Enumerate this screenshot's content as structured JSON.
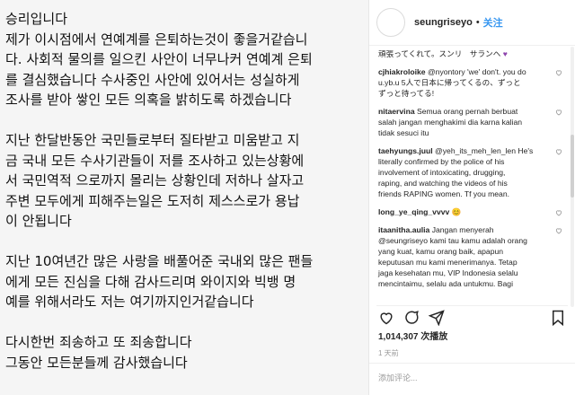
{
  "post": {
    "lines": [
      "승리입니다",
      "제가 이시점에서 연예계를 은퇴하는것이 좋을거같습니",
      "다. 사회적 물의를 일으킨 사안이 너무나커 연예계 은퇴",
      "를 결심했습니다 수사중인 사안에 있어서는 성실하게",
      "조사를 받아 쌓인 모든 의혹을 밝히도록 하겠습니다",
      "",
      "지난 한달반동안 국민들로부터 질타받고 미움받고 지",
      "금 국내 모든 수사기관들이 저를 조사하고 있는상황에",
      "서 국민역적 으로까지 몰리는 상황인데 저하나 살자고",
      "주변 모두에게 피해주는일은 도저히 제스스로가 용납",
      "이 안됩니다",
      "",
      "지난 10여년간 많은 사랑을 배풀어준 국내외 많은 팬들",
      "에게 모든 진심을 다해 감사드리며   와이지와 빅뱅 명",
      "예를 위해서라도 저는 여기까지인거같습니다",
      "",
      "다시한번 죄송하고 또 죄송합니다",
      "그동안 모든분들께 감사했습니다"
    ]
  },
  "header": {
    "username": "seungriseyo",
    "dot": "•",
    "follow_label": "关注"
  },
  "comments": {
    "partial_top": "頑張ってくれて。スンリ　サランヘ",
    "items": [
      {
        "user": "cjhiakroloike",
        "lines": [
          "@nyontory 'we' don't. you do",
          "u.yb.u 5人で日本に帰ってくるの、ずっと",
          "ずっと待ってる!"
        ]
      },
      {
        "user": "nitaervina",
        "lines": [
          "Semua orang pernah berbuat",
          "salah jangan menghakimi dia karna kalian",
          "tidak sesuci itu"
        ]
      },
      {
        "user": "taehyungs.juul",
        "lines": [
          "@yeh_its_meh_len_len He's",
          "literally confirmed by the police of his",
          "involvement of intoxicating, drugging,",
          "raping, and watching the videos of his",
          "friends RAPING women. Tf you mean."
        ]
      },
      {
        "user": "long_ye_qing_vvvv",
        "lines": [
          "😊"
        ]
      },
      {
        "user": "itaanitha.aulia",
        "lines": [
          "Jangan menyerah",
          "@seungriseyo kami tau kamu adalah orang",
          "yang kuat, kamu orang baik, apapun",
          "keputusan mu kami menerimanya. Tetap",
          "jaga kesehatan mu, VIP Indonesia selalu",
          "mencintaimu, selalu ada untukmu. Bagi"
        ]
      }
    ]
  },
  "stats": {
    "views": "1,014,307",
    "views_unit": "次播放",
    "time": "1 天前",
    "add_comment_placeholder": "添加评论..."
  }
}
